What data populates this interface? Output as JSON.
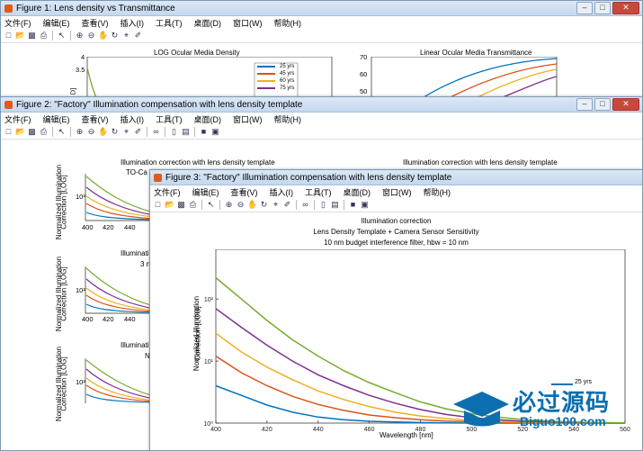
{
  "colors": {
    "y25": "#0072bd",
    "y45": "#d95319",
    "y60": "#edb120",
    "y75": "#7e2f8e",
    "y90": "#77ac30",
    "accent": "#0b6fb0"
  },
  "menu": [
    "文件(F)",
    "编辑(E)",
    "查看(V)",
    "插入(I)",
    "工具(T)",
    "桌面(D)",
    "窗口(W)",
    "帮助(H)"
  ],
  "fig1": {
    "title": "Figure 1: Lens density vs Transmittance",
    "left": {
      "title": "LOG Ocular Media Density",
      "yticks": [
        "4",
        "3.5"
      ],
      "ylabel_fragment": "D]"
    },
    "right": {
      "title": "Linear Ocular Media Transmittance",
      "yticks": [
        "70",
        "60",
        "50"
      ]
    },
    "legend": [
      "25 yrs",
      "45 yrs",
      "60 yrs",
      "75 yrs"
    ]
  },
  "fig2": {
    "title": "Figure 2: \"Factory\" Illumination compensation with lens density template",
    "left_title": "Illumination correction with lens density template",
    "left_title_frag": "TO-Ca",
    "right_title": "Illumination correction with lens density template",
    "mid_title": "Illuminati",
    "mid_sub": "3 n",
    "bot_title": "Illuminati",
    "bot_sub": "N",
    "ylabel1": "Normalized Illumination",
    "ylabel2": "Correction [LOG]",
    "yt": "10²",
    "xticks": [
      "400",
      "420",
      "440"
    ]
  },
  "fig3": {
    "title": "Figure 3: \"Factory\" Illumination compensation with lens density template",
    "title1": "Illumination correction",
    "title2": "Lens Density Template + Camera Sensor Sensitivity",
    "title3": "10 nm budget interference filter, hbw = 10 nm",
    "xlabel": "Wavelength [nm]",
    "ylabel1": "Normalized Illumination",
    "ylabel2": "Correction [LOG]",
    "legend_visible": "25 yrs"
  },
  "chart_data": {
    "type": "line",
    "title": "Illumination correction",
    "subtitle": "Lens Density Template + Camera Sensor Sensitivity; 10 nm budget interference filter, hbw = 10 nm",
    "xlabel": "Wavelength [nm]",
    "ylabel": "Normalized Illumination Correction [LOG]",
    "yscale": "log",
    "xlim": [
      400,
      560
    ],
    "ylim_exp": [
      0,
      2.8
    ],
    "xticks": [
      400,
      420,
      440,
      460,
      480,
      500,
      520,
      540,
      560
    ],
    "yticks": [
      "10⁰",
      "10¹",
      "10²"
    ],
    "x": [
      400,
      410,
      420,
      430,
      440,
      450,
      460,
      470,
      480,
      490,
      500,
      510,
      520,
      530,
      540,
      550,
      560
    ],
    "series": [
      {
        "name": "25 yrs",
        "color": "#0072bd",
        "values": [
          4,
          2.8,
          1.95,
          1.5,
          1.25,
          1.13,
          1.07,
          1.04,
          1.02,
          1.01,
          1.0,
          1.0,
          1.0,
          1.0,
          1.0,
          1.0,
          1.0
        ]
      },
      {
        "name": "",
        "color": "#d95319",
        "values": [
          12,
          6.5,
          4,
          2.7,
          2,
          1.6,
          1.35,
          1.22,
          1.13,
          1.08,
          1.05,
          1.03,
          1.02,
          1.01,
          1.0,
          1.0,
          1.0
        ]
      },
      {
        "name": "",
        "color": "#edb120",
        "values": [
          28,
          14,
          8,
          5,
          3.3,
          2.4,
          1.85,
          1.5,
          1.3,
          1.18,
          1.1,
          1.06,
          1.04,
          1.02,
          1.01,
          1.0,
          1.0
        ]
      },
      {
        "name": "",
        "color": "#7e2f8e",
        "values": [
          70,
          35,
          18,
          10,
          6,
          4,
          2.8,
          2.1,
          1.65,
          1.38,
          1.22,
          1.13,
          1.07,
          1.04,
          1.02,
          1.01,
          1.0
        ]
      },
      {
        "name": "",
        "color": "#77ac30",
        "values": [
          220,
          100,
          45,
          22,
          12,
          7,
          4.5,
          3.1,
          2.2,
          1.7,
          1.42,
          1.25,
          1.14,
          1.08,
          1.04,
          1.02,
          1.01
        ]
      }
    ]
  },
  "watermark": {
    "brand": "必过源码",
    "site": "Biguo100.com"
  }
}
